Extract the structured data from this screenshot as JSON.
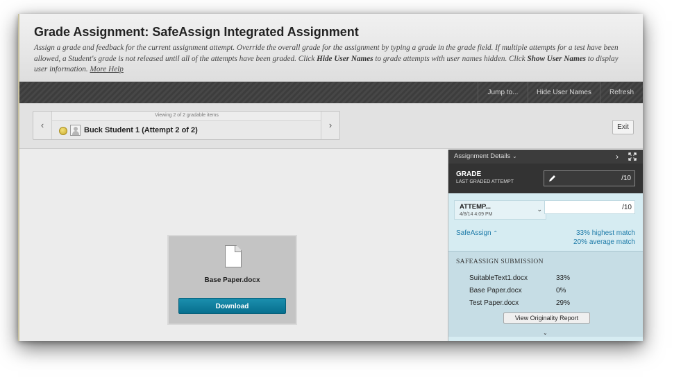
{
  "header": {
    "title": "Grade Assignment: SafeAssign Integrated Assignment",
    "instructions_part1": "Assign a grade and feedback for the current assignment attempt. Override the overall grade for the assignment by typing a grade in the grade field. If multiple attempts for a test have been allowed, a Student's grade is not released until all of the attempts have been graded. Click ",
    "hide_user_names": "Hide User Names",
    "instructions_part2": " to grade attempts with user names hidden. Click ",
    "show_user_names": "Show User Names",
    "instructions_part3": " to display user information. ",
    "more_help": "More Help"
  },
  "toolbar": {
    "jump_to": "Jump to...",
    "hide_user_names": "Hide User Names",
    "refresh": "Refresh"
  },
  "navigator": {
    "viewing": "Viewing 2 of 2 gradable items",
    "student": "Buck Student 1 (Attempt 2 of 2)",
    "prev_icon": "chevron-left-icon",
    "next_icon": "chevron-right-icon",
    "exit": "Exit"
  },
  "document": {
    "file_name": "Base Paper.docx",
    "download": "Download",
    "icon": "document-icon"
  },
  "panel": {
    "assignment_details": "Assignment Details",
    "grade_label": "GRADE",
    "grade_sub": "LAST GRADED ATTEMPT",
    "grade_max": "/10",
    "attempt_label": "ATTEMP...",
    "attempt_date": "4/8/14 4:09 PM",
    "attempt_max": "/10",
    "safeassign": "SafeAssign",
    "highest_match": "33% highest match",
    "average_match": "20% average match",
    "submission_title": "SAFEASSIGN SUBMISSION",
    "submissions": [
      {
        "name": "SuitableText1.docx",
        "percent": "33%"
      },
      {
        "name": "Base Paper.docx",
        "percent": "0%"
      },
      {
        "name": "Test Paper.docx",
        "percent": "29%"
      }
    ],
    "view_report": "View Originality Report"
  },
  "colors": {
    "accent": "#1c7aa8",
    "download_button": "#0a7c9c",
    "panel_bg": "#d6ecf2",
    "toolbar": "#424242"
  }
}
